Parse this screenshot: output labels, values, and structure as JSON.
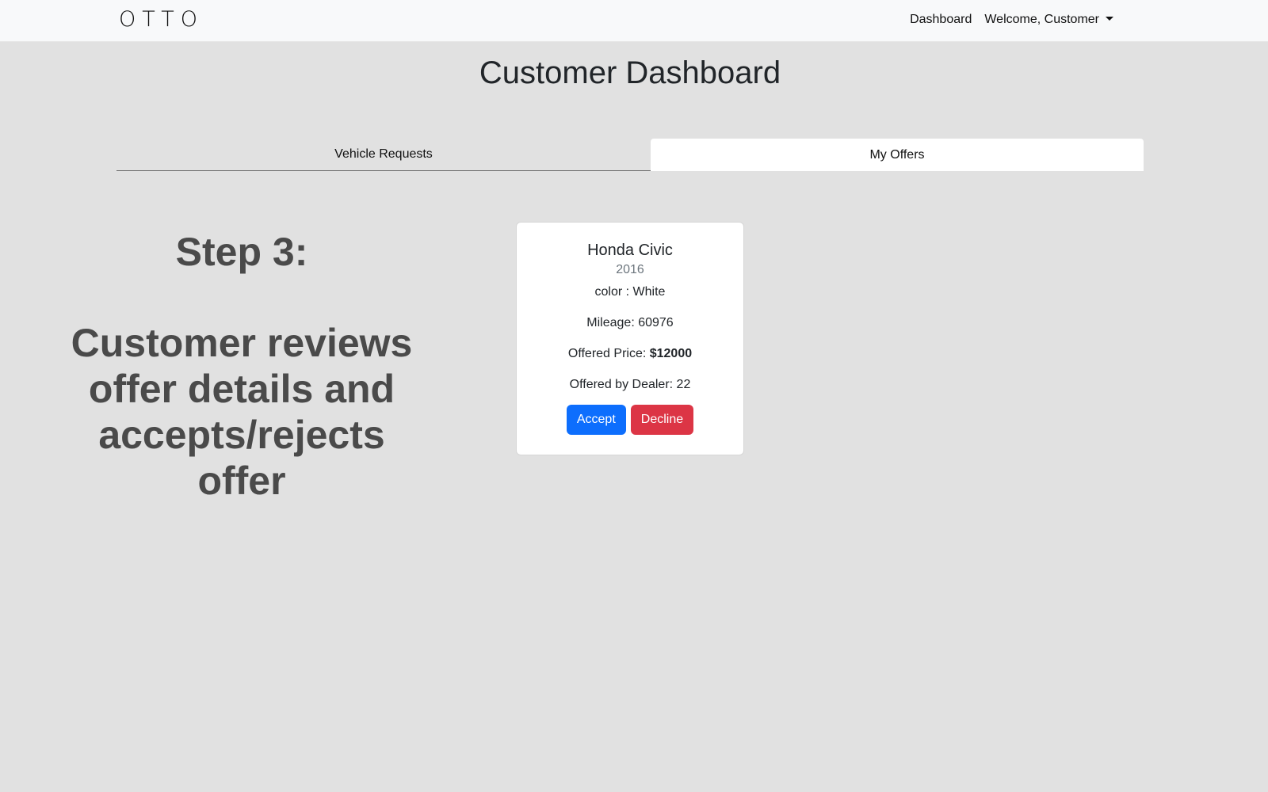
{
  "navbar": {
    "brand": "OTTO",
    "links": {
      "dashboard": "Dashboard",
      "welcome": "Welcome, Customer"
    }
  },
  "page": {
    "title": "Customer Dashboard"
  },
  "tabs": {
    "vehicle_requests": "Vehicle Requests",
    "my_offers": "My Offers",
    "active": "My Offers"
  },
  "step": {
    "title": "Step 3:",
    "description": "Customer reviews offer details and accepts/rejects offer"
  },
  "offer": {
    "make_model": "Honda Civic",
    "year": "2016",
    "color_label": "color : ",
    "color": "White",
    "mileage_label": "Mileage: ",
    "mileage": "60976",
    "price_label": "Offered Price: ",
    "price": "$12000",
    "dealer_label": "Offered by Dealer: ",
    "dealer": "22",
    "accept_label": "Accept",
    "decline_label": "Decline"
  },
  "colors": {
    "accept": "#0d6efd",
    "decline": "#dc3545",
    "background": "#e1e1e1",
    "navbar": "#f8f9fa"
  }
}
